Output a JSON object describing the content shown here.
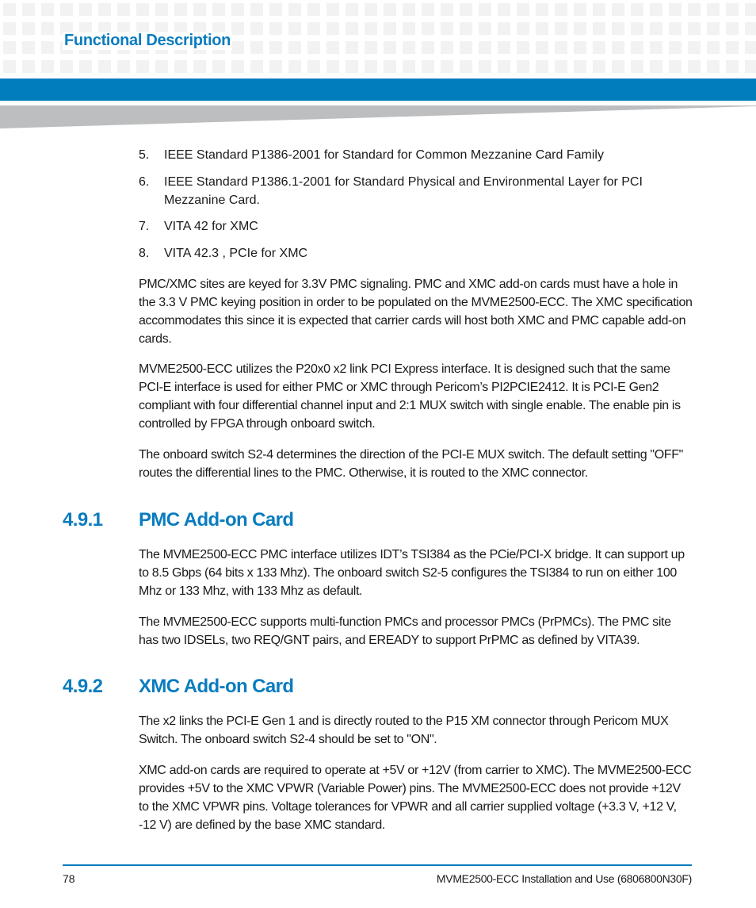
{
  "header": {
    "chapter_title": "Functional Description",
    "accent_color": "#017dbe"
  },
  "list_items": [
    {
      "number": "5.",
      "text": "IEEE Standard P1386-2001 for Standard for Common Mezzanine Card Family"
    },
    {
      "number": "6.",
      "text": "IEEE Standard P1386.1-2001 for Standard Physical and Environmental Layer for PCI Mezzanine Card."
    },
    {
      "number": "7.",
      "text": "VITA 42 for XMC"
    },
    {
      "number": "8.",
      "text": "VITA 42.3 , PCIe for XMC"
    }
  ],
  "intro_paragraphs": [
    "PMC/XMC sites are keyed for 3.3V PMC signaling. PMC and XMC add-on cards must have a hole in the 3.3 V PMC keying position in order to be populated on the MVME2500-ECC. The XMC specification accommodates this since it is expected that carrier cards will host both XMC and PMC capable add-on cards.",
    "MVME2500-ECC utilizes the P20x0 x2 link PCI Express interface. It is designed such that the same PCI-E interface is used for either PMC or XMC through Pericom’s PI2PCIE2412. It is PCI-E Gen2 compliant with four differential channel input and 2:1 MUX switch with single enable. The enable pin is controlled by FPGA through onboard switch.",
    "The onboard switch S2-4 determines the direction of the PCI-E MUX switch. The default setting \"OFF\" routes the differential lines to the PMC. Otherwise, it is routed to the XMC connector."
  ],
  "sections": [
    {
      "number": "4.9.1",
      "title": "PMC Add-on Card",
      "paragraphs": [
        "The MVME2500-ECC PMC interface utilizes IDT’s TSI384 as the PCie/PCI-X bridge. It can support up to 8.5 Gbps (64 bits x 133 Mhz). The onboard switch S2-5 configures the TSI384 to run on either 100 Mhz or 133 Mhz, with 133 Mhz as default.",
        "The MVME2500-ECC supports multi-function PMCs and processor PMCs (PrPMCs). The PMC site has two IDSELs, two REQ/GNT pairs, and EREADY to support PrPMC as defined by VITA39."
      ]
    },
    {
      "number": "4.9.2",
      "title": "XMC Add-on Card",
      "paragraphs": [
        "The x2 links the PCI-E Gen 1 and is directly routed to the P15 XM connector through Pericom MUX Switch. The onboard switch S2-4 should be set to \"ON\".",
        "XMC add-on cards are required to operate at +5V or +12V (from carrier to XMC). The MVME2500-ECC provides +5V to the XMC VPWR (Variable Power) pins. The MVME2500-ECC does not provide +12V to the XMC VPWR pins. Voltage tolerances for VPWR and all carrier supplied voltage (+3.3 V, +12 V, -12 V) are defined by the base XMC standard."
      ]
    }
  ],
  "footer": {
    "page_number": "78",
    "document_title": "MVME2500-ECC Installation and Use (6806800N30F)"
  }
}
